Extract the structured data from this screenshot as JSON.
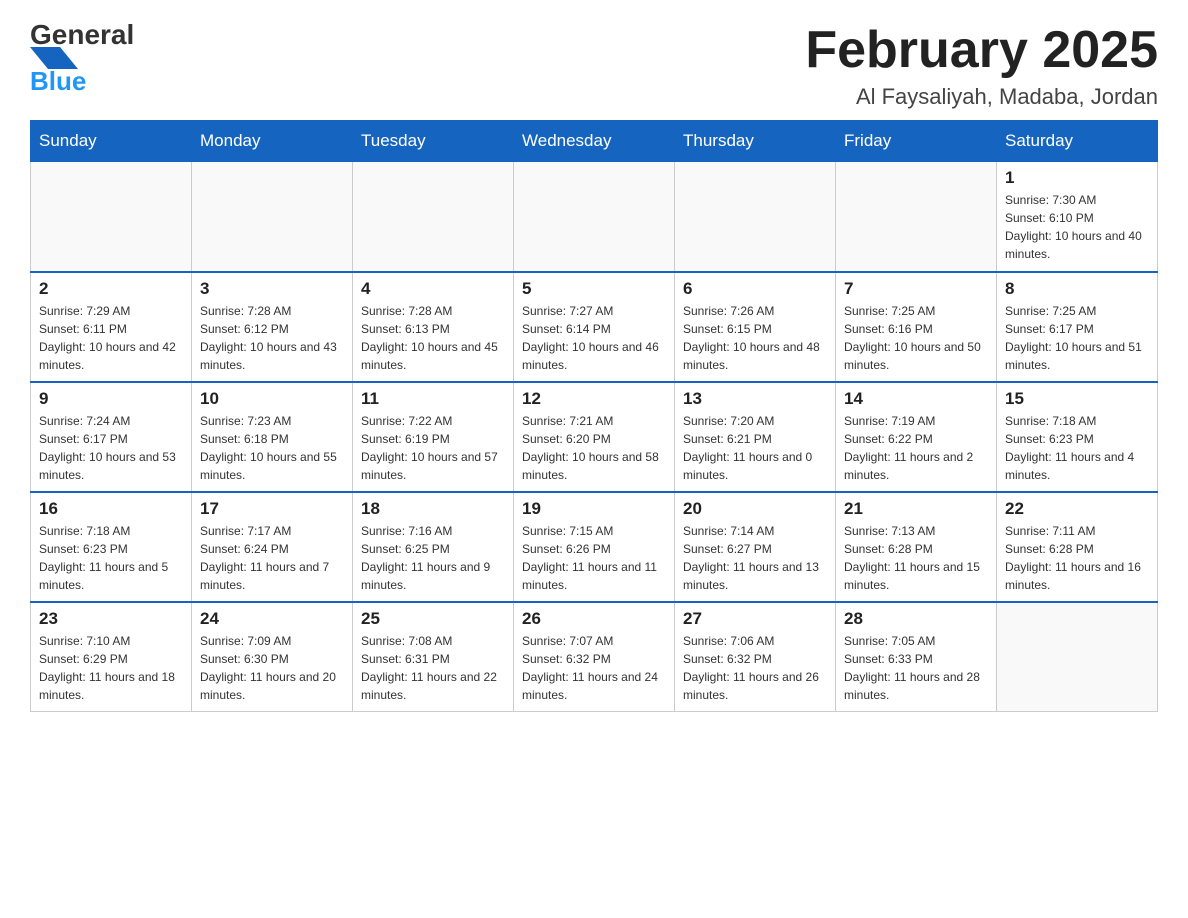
{
  "header": {
    "logo_general": "General",
    "logo_blue": "Blue",
    "month_title": "February 2025",
    "location": "Al Faysaliyah, Madaba, Jordan"
  },
  "days_of_week": [
    "Sunday",
    "Monday",
    "Tuesday",
    "Wednesday",
    "Thursday",
    "Friday",
    "Saturday"
  ],
  "weeks": [
    [
      {
        "day": "",
        "info": ""
      },
      {
        "day": "",
        "info": ""
      },
      {
        "day": "",
        "info": ""
      },
      {
        "day": "",
        "info": ""
      },
      {
        "day": "",
        "info": ""
      },
      {
        "day": "",
        "info": ""
      },
      {
        "day": "1",
        "info": "Sunrise: 7:30 AM\nSunset: 6:10 PM\nDaylight: 10 hours and 40 minutes."
      }
    ],
    [
      {
        "day": "2",
        "info": "Sunrise: 7:29 AM\nSunset: 6:11 PM\nDaylight: 10 hours and 42 minutes."
      },
      {
        "day": "3",
        "info": "Sunrise: 7:28 AM\nSunset: 6:12 PM\nDaylight: 10 hours and 43 minutes."
      },
      {
        "day": "4",
        "info": "Sunrise: 7:28 AM\nSunset: 6:13 PM\nDaylight: 10 hours and 45 minutes."
      },
      {
        "day": "5",
        "info": "Sunrise: 7:27 AM\nSunset: 6:14 PM\nDaylight: 10 hours and 46 minutes."
      },
      {
        "day": "6",
        "info": "Sunrise: 7:26 AM\nSunset: 6:15 PM\nDaylight: 10 hours and 48 minutes."
      },
      {
        "day": "7",
        "info": "Sunrise: 7:25 AM\nSunset: 6:16 PM\nDaylight: 10 hours and 50 minutes."
      },
      {
        "day": "8",
        "info": "Sunrise: 7:25 AM\nSunset: 6:17 PM\nDaylight: 10 hours and 51 minutes."
      }
    ],
    [
      {
        "day": "9",
        "info": "Sunrise: 7:24 AM\nSunset: 6:17 PM\nDaylight: 10 hours and 53 minutes."
      },
      {
        "day": "10",
        "info": "Sunrise: 7:23 AM\nSunset: 6:18 PM\nDaylight: 10 hours and 55 minutes."
      },
      {
        "day": "11",
        "info": "Sunrise: 7:22 AM\nSunset: 6:19 PM\nDaylight: 10 hours and 57 minutes."
      },
      {
        "day": "12",
        "info": "Sunrise: 7:21 AM\nSunset: 6:20 PM\nDaylight: 10 hours and 58 minutes."
      },
      {
        "day": "13",
        "info": "Sunrise: 7:20 AM\nSunset: 6:21 PM\nDaylight: 11 hours and 0 minutes."
      },
      {
        "day": "14",
        "info": "Sunrise: 7:19 AM\nSunset: 6:22 PM\nDaylight: 11 hours and 2 minutes."
      },
      {
        "day": "15",
        "info": "Sunrise: 7:18 AM\nSunset: 6:23 PM\nDaylight: 11 hours and 4 minutes."
      }
    ],
    [
      {
        "day": "16",
        "info": "Sunrise: 7:18 AM\nSunset: 6:23 PM\nDaylight: 11 hours and 5 minutes."
      },
      {
        "day": "17",
        "info": "Sunrise: 7:17 AM\nSunset: 6:24 PM\nDaylight: 11 hours and 7 minutes."
      },
      {
        "day": "18",
        "info": "Sunrise: 7:16 AM\nSunset: 6:25 PM\nDaylight: 11 hours and 9 minutes."
      },
      {
        "day": "19",
        "info": "Sunrise: 7:15 AM\nSunset: 6:26 PM\nDaylight: 11 hours and 11 minutes."
      },
      {
        "day": "20",
        "info": "Sunrise: 7:14 AM\nSunset: 6:27 PM\nDaylight: 11 hours and 13 minutes."
      },
      {
        "day": "21",
        "info": "Sunrise: 7:13 AM\nSunset: 6:28 PM\nDaylight: 11 hours and 15 minutes."
      },
      {
        "day": "22",
        "info": "Sunrise: 7:11 AM\nSunset: 6:28 PM\nDaylight: 11 hours and 16 minutes."
      }
    ],
    [
      {
        "day": "23",
        "info": "Sunrise: 7:10 AM\nSunset: 6:29 PM\nDaylight: 11 hours and 18 minutes."
      },
      {
        "day": "24",
        "info": "Sunrise: 7:09 AM\nSunset: 6:30 PM\nDaylight: 11 hours and 20 minutes."
      },
      {
        "day": "25",
        "info": "Sunrise: 7:08 AM\nSunset: 6:31 PM\nDaylight: 11 hours and 22 minutes."
      },
      {
        "day": "26",
        "info": "Sunrise: 7:07 AM\nSunset: 6:32 PM\nDaylight: 11 hours and 24 minutes."
      },
      {
        "day": "27",
        "info": "Sunrise: 7:06 AM\nSunset: 6:32 PM\nDaylight: 11 hours and 26 minutes."
      },
      {
        "day": "28",
        "info": "Sunrise: 7:05 AM\nSunset: 6:33 PM\nDaylight: 11 hours and 28 minutes."
      },
      {
        "day": "",
        "info": ""
      }
    ]
  ]
}
